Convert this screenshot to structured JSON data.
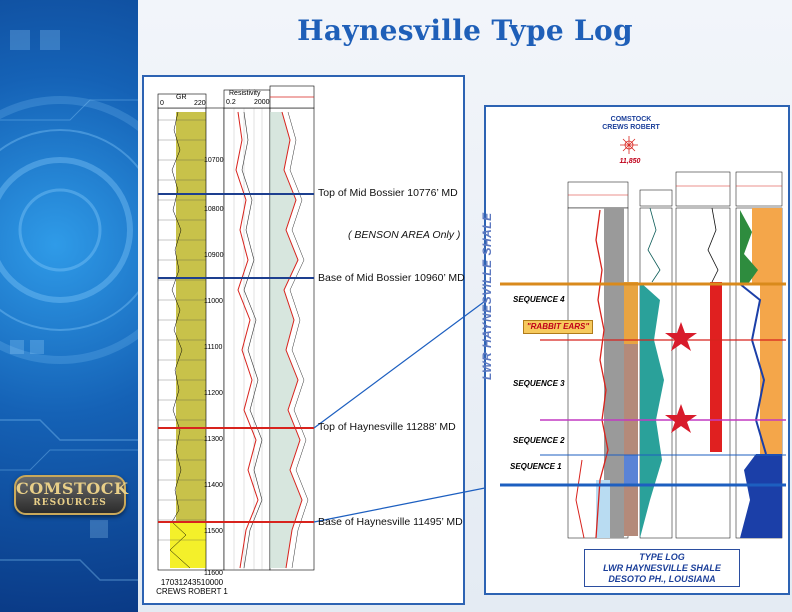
{
  "slide": {
    "title": "Haynesville Type Log"
  },
  "logo": {
    "line1": "COMSTOCK",
    "line2": "RESOURCES"
  },
  "left_log": {
    "gr_header": {
      "label": "GR",
      "min": "0",
      "max": "220"
    },
    "res_header": {
      "label": "Resistivity",
      "min": "0.2",
      "max": "2000"
    },
    "depths": [
      "10700",
      "10800",
      "10900",
      "11000",
      "11100",
      "11200",
      "11300",
      "11400",
      "11500",
      "11600"
    ],
    "well_id": "17031243510000",
    "well_name": "CREWS ROBERT 1"
  },
  "annotations": {
    "top_mid_bossier": "Top of Mid Bossier 10776’ MD",
    "benson": "( BENSON AREA Only )",
    "base_mid_bossier": "Base of Mid Bossier 10960’ MD",
    "top_haynesville": "Top of Haynesville 11288’ MD",
    "base_haynesville": "Base of Haynesville 11495’ MD"
  },
  "right_log": {
    "well_header": {
      "company": "COMSTOCK",
      "well": "CREWS ROBERT",
      "number": "11,850"
    },
    "title_vertical": "LWR HAYNESVILLE SHALE",
    "sequences": [
      "SEQUENCE 4",
      "SEQUENCE 3",
      "SEQUENCE 2",
      "SEQUENCE 1"
    ],
    "rabbit_ears": "\"RABBIT EARS\"",
    "caption": [
      "TYPE LOG",
      "LWR HAYNESVILLE SHALE",
      "DESOTO PH., LOUSIANA"
    ]
  },
  "colors": {
    "title": "#1f5fb8",
    "panel_border": "#2d63b3",
    "bossier_line": "#1d3f8f",
    "haynesville_line": "#d8231d",
    "gr_fill": "#c8c24a",
    "orange_line": "#d98a1c",
    "magenta_line": "#c23ac2",
    "star": "#d81b2b"
  }
}
